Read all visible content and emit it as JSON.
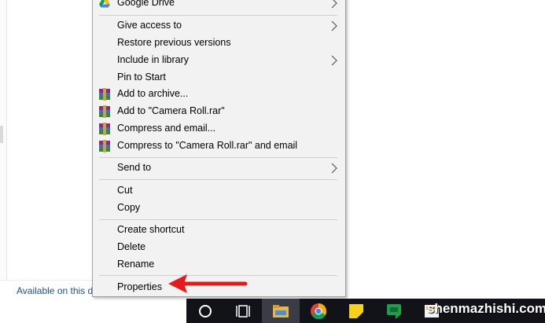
{
  "explorer": {
    "status_text": "Available on this d"
  },
  "menu": {
    "items": [
      {
        "label": "Google Drive"
      },
      {
        "label": "Give access to"
      },
      {
        "label": "Restore previous versions"
      },
      {
        "label": "Include in library"
      },
      {
        "label": "Pin to Start"
      },
      {
        "label": "Add to archive..."
      },
      {
        "label": "Add to \"Camera Roll.rar\""
      },
      {
        "label": "Compress and email..."
      },
      {
        "label": "Compress to \"Camera Roll.rar\" and email"
      },
      {
        "label": "Send to"
      },
      {
        "label": "Cut"
      },
      {
        "label": "Copy"
      },
      {
        "label": "Create shortcut"
      },
      {
        "label": "Delete"
      },
      {
        "label": "Rename"
      },
      {
        "label": "Properties"
      }
    ]
  },
  "icons": {
    "google_drive": "google-drive-icon",
    "winrar": "winrar-icon",
    "chevron": "chevron-right-icon",
    "arrow": "red-arrow-icon"
  },
  "taskbar": {
    "buttons": [
      "cortana-circle-icon",
      "task-view-icon",
      "file-explorer-icon",
      "chrome-icon",
      "sticky-notes-icon",
      "hangouts-icon",
      "app-icon"
    ]
  },
  "watermark": "shenmazhishi.com",
  "colors": {
    "menu_bg": "#f2f2f2",
    "arrow": "#e8191a",
    "taskbar": "#111319",
    "link": "#1f4e8c"
  }
}
